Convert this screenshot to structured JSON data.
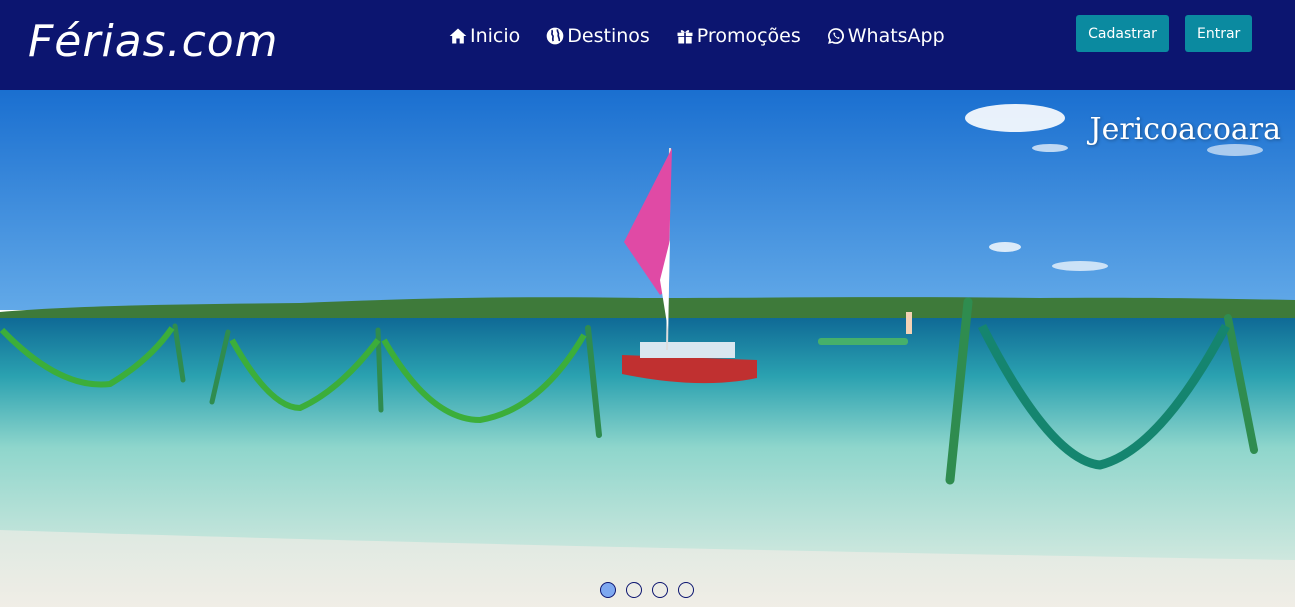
{
  "brand": {
    "name": "Férias.com"
  },
  "nav": {
    "items": [
      {
        "label": "Inicio",
        "icon": "home-icon"
      },
      {
        "label": "Destinos",
        "icon": "globe-icon"
      },
      {
        "label": "Promoções",
        "icon": "gift-icon"
      },
      {
        "label": "WhatsApp",
        "icon": "whatsapp-icon"
      }
    ]
  },
  "auth": {
    "signup_label": "Cadastrar",
    "login_label": "Entrar"
  },
  "carousel": {
    "caption": "Jericoacoara",
    "slide_count": 4,
    "active_slide": 1
  },
  "colors": {
    "navbar": "#0c1570",
    "button": "#0b8aa0",
    "indicator_active": "#7ea8f0"
  }
}
